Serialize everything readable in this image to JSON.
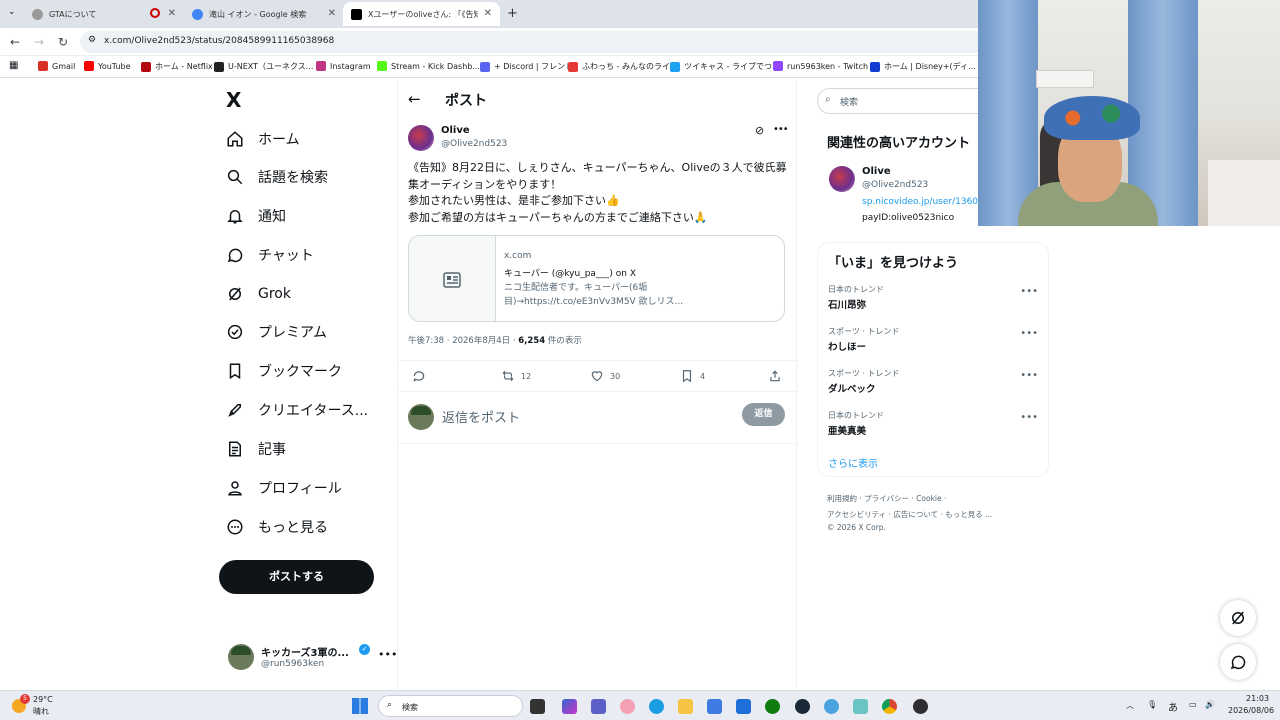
{
  "browser": {
    "tabs": [
      {
        "title": "GTAについて",
        "color": "#777"
      },
      {
        "title": "滝山 イオン - Google 検索",
        "color": "#4285f4"
      },
      {
        "title": "Xユーザーのoliveさん: 「《告知》8月",
        "color": "#000"
      }
    ],
    "url": "x.com/Olive2nd523/status/2084589911165038968",
    "bookmarks": [
      {
        "label": "Gmail",
        "color": "#d93025"
      },
      {
        "label": "YouTube",
        "color": "#ff0000"
      },
      {
        "label": "ホーム - Netflix",
        "color": "#b20710"
      },
      {
        "label": "U-NEXT（ユーネクス...",
        "color": "#222"
      },
      {
        "label": "Instagram",
        "color": "#c13584"
      },
      {
        "label": "Stream - Kick Dashb...",
        "color": "#53fc18"
      },
      {
        "label": "+ Discord | フレンド",
        "color": "#5865f2"
      },
      {
        "label": "ふわっち - みんなのライ...",
        "color": "#e53935"
      },
      {
        "label": "ツイキャス - ライブでつ...",
        "color": "#1da1f2"
      },
      {
        "label": "run5963ken - Twitch",
        "color": "#9146ff"
      },
      {
        "label": "ホーム | Disney+(ディ...",
        "color": "#113ccf"
      }
    ]
  },
  "nav": {
    "logo": "X",
    "items": [
      "ホーム",
      "話題を検索",
      "通知",
      "チャット",
      "Grok",
      "プレミアム",
      "ブックマーク",
      "クリエイタース...",
      "記事",
      "プロフィール",
      "もっと見る"
    ],
    "post_button": "ポストする",
    "account_name": "キッカーズ3軍の...",
    "account_handle": "@run5963ken"
  },
  "post": {
    "header": "ポスト",
    "author": "Olive",
    "handle": "@Olive2nd523",
    "lines": [
      "《告知》8月22日に、しぇりさん、キューパーちゃん、Oliveの３人で彼氏募集オーディションをやります！",
      "参加されたい男性は、是非ご参加下さい👍",
      "参加ご希望の方はキューパーちゃんの方までご連絡下さい🙏"
    ],
    "card": {
      "domain": "x.com",
      "title": "キューパー (@kyu_pa___) on X",
      "desc": "ニコ生配信者です。キューパー(6垢目)→https://t.co/eE3nVv3M5V 欲しリス..."
    },
    "time": "午後7:38 · 2026年8月4日 · ",
    "views": "6,254",
    "views_suffix": " 件の表示",
    "retweets": "12",
    "likes": "30",
    "bookmarks": "4",
    "reply_placeholder": "返信をポスト",
    "reply_button": "返信"
  },
  "right": {
    "search_placeholder": "検索",
    "related_title": "関連性の高いアカウント",
    "related_name": "Olive",
    "related_handle": "@Olive2nd523",
    "related_link": "sp.nicovideo.jp/user/1360",
    "related_bio": "payID:olive0523nico",
    "trends_title": "「いま」を見つけよう",
    "trends": [
      {
        "cat": "日本のトレンド",
        "name": "石川昂弥"
      },
      {
        "cat": "スポーツ · トレンド",
        "name": "わしほー"
      },
      {
        "cat": "スポーツ · トレンド",
        "name": "ダルベック"
      },
      {
        "cat": "日本のトレンド",
        "name": "亜美真美"
      }
    ],
    "show_more": "さらに表示",
    "footer1": "利用規約 · プライバシー · Cookie ·",
    "footer2": "アクセシビリティ · 広告について · もっと見る ...",
    "footer3": "© 2026 X Corp."
  },
  "taskbar": {
    "temp": "29°C",
    "weather": "晴れ",
    "weather_badge": "5",
    "search": "検索",
    "ime": "あ",
    "time": "21:03",
    "date": "2026/08/06"
  }
}
